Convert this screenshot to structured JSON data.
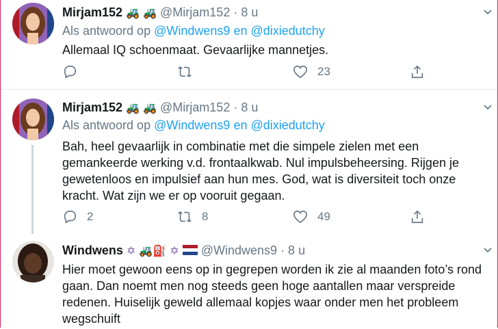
{
  "tweets": [
    {
      "name": "Mirjam152",
      "badges": "🚜 🚜",
      "handle": "@Mirjam152",
      "time": "· 8 u",
      "reply_prefix": "Als antwoord op",
      "reply_user1": "@Windwens9",
      "reply_sep": "en",
      "reply_user2": "@dixiedutchy",
      "text": "Allemaal IQ schoenmaat. Gevaarlijke mannetjes.",
      "replies": "",
      "retweets": "",
      "likes": "23"
    },
    {
      "name": "Mirjam152",
      "badges": "🚜 🚜",
      "handle": "@Mirjam152",
      "time": "· 8 u",
      "reply_prefix": "Als antwoord op",
      "reply_user1": "@Windwens9",
      "reply_sep": "en",
      "reply_user2": "@dixiedutchy",
      "text": "Bah, heel gevaarlijk in combinatie met die simpele zielen met een gemankeerde werking v.d. frontaalkwab. Nul impulsbeheersing. Rijgen je gewetenloos en impulsief aan hun mes. God, wat is diversiteit toch onze kracht. Wat zijn we er op vooruit gegaan.",
      "replies": "2",
      "retweets": "8",
      "likes": "49"
    },
    {
      "name": "Windwens",
      "badges": "✡ 🚜⛽ ✡",
      "handle": "@Windwens9",
      "time": "· 8 u",
      "text": "Hier moet gewoon eens op in gegrepen worden ik zie al maanden foto’s rond gaan. Dan noemt men nog steeds geen hoge aantallen maar verspreide redenen. Huiselijk geweld allemaal kopjes waar onder men het probleem wegschuift"
    }
  ],
  "colors": {
    "link": "#1da1f2",
    "secondary": "#657786",
    "flag_red": "#ae1c28",
    "flag_blue": "#21468b",
    "star": "#7d5ba6"
  }
}
